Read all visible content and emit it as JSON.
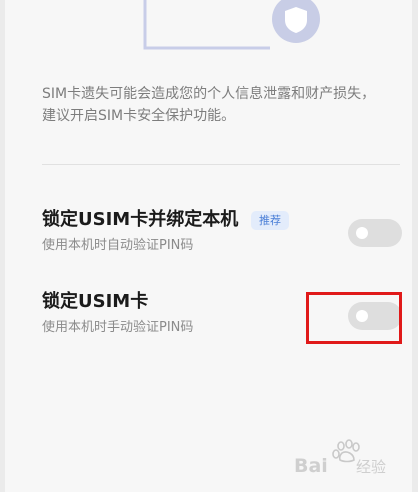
{
  "description_text": "SIM卡遗失可能会造成您的个人信息泄露和财产损失，\n建议开启SIM卡安全保护功能。",
  "settings": [
    {
      "title": "锁定USIM卡并绑定本机",
      "subtitle": "使用本机时自动验证PIN码",
      "badge": "推荐",
      "enabled": false
    },
    {
      "title": "锁定USIM卡",
      "subtitle": "使用本机时手动验证PIN码",
      "enabled": false
    }
  ],
  "icons": {
    "illustration_shield": "shield-icon"
  },
  "colors": {
    "background": "#f7f7f7",
    "badge_bg": "#e3ecfb",
    "badge_text": "#4a7ed6",
    "toggle_off": "#dedede",
    "highlight": "#e01919"
  },
  "watermark_text": "Bai 经验"
}
